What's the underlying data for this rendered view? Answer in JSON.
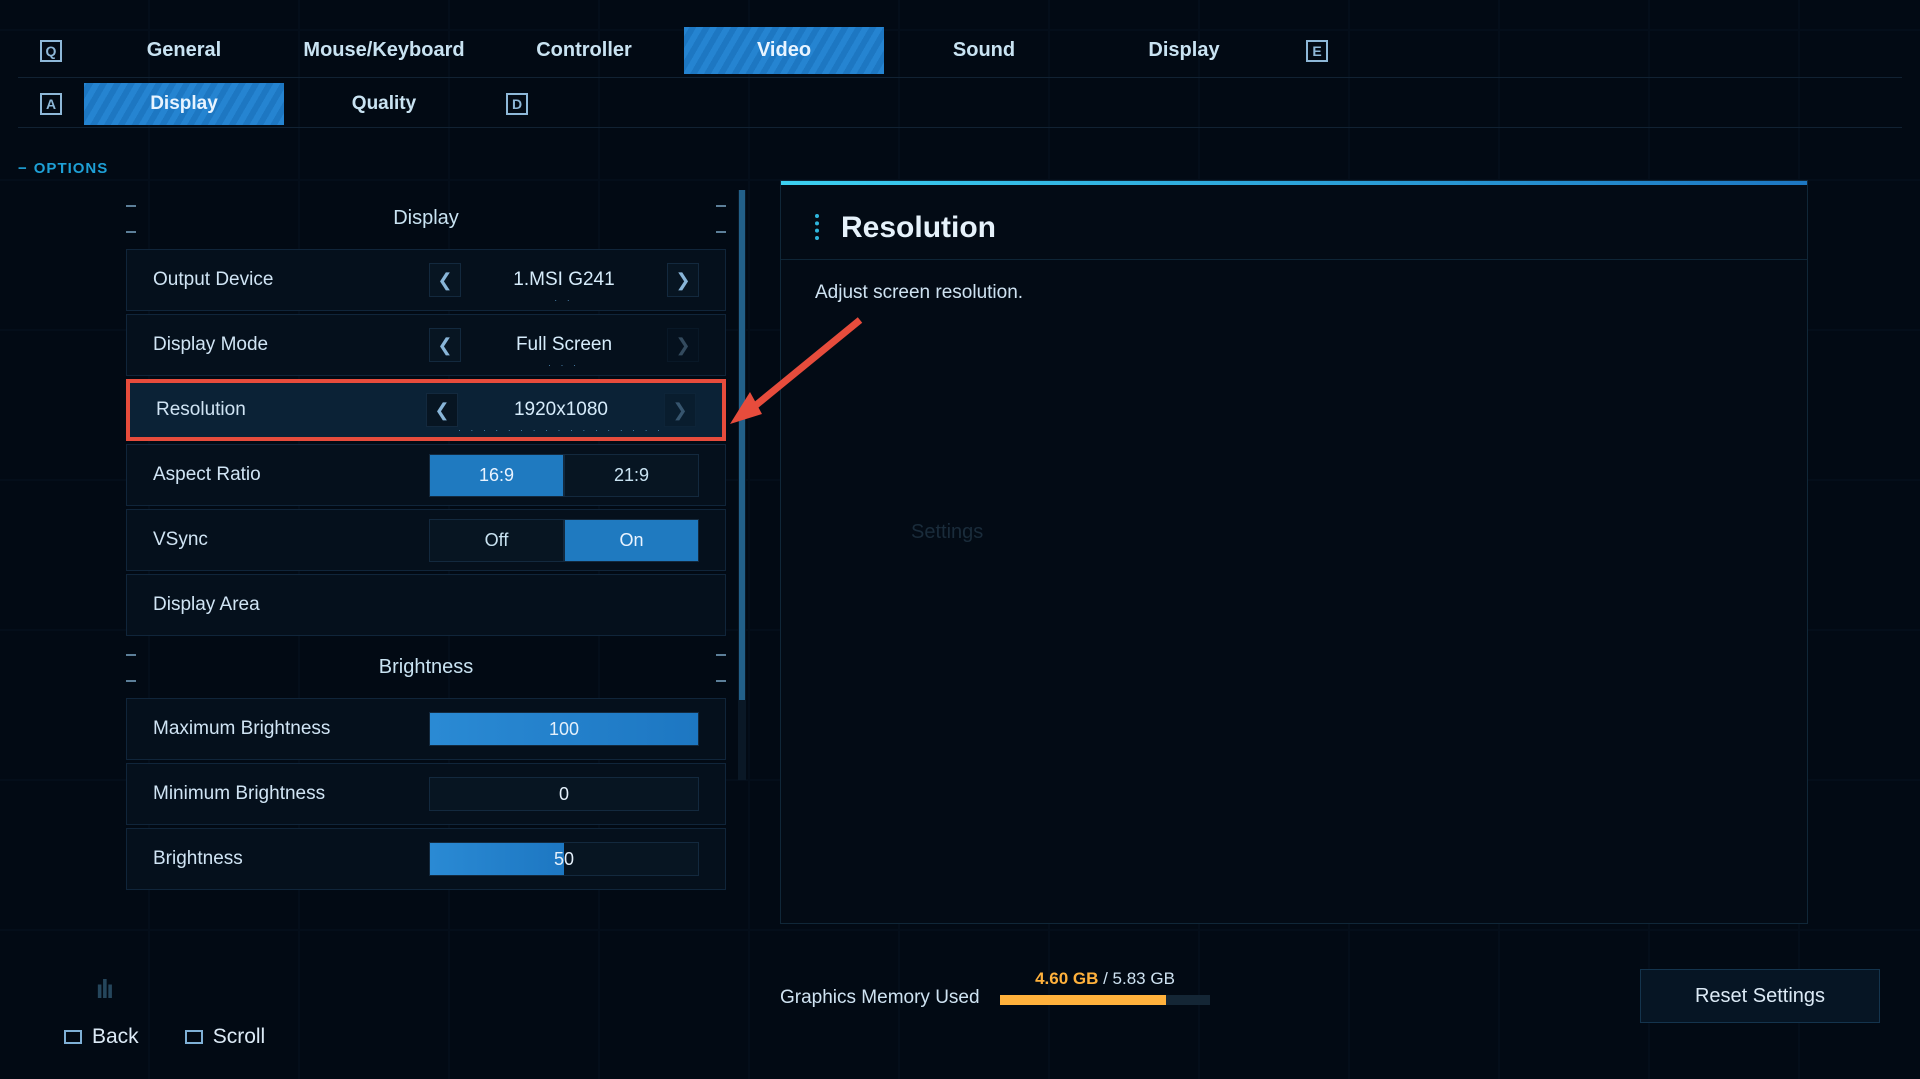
{
  "keys": {
    "left": "Q",
    "right": "E",
    "secLeft": "A",
    "secRight": "D"
  },
  "tabs": [
    "General",
    "Mouse/Keyboard",
    "Controller",
    "Video",
    "Sound",
    "Display"
  ],
  "subtabs": [
    "Display",
    "Quality"
  ],
  "options_label": "OPTIONS",
  "sections": {
    "display_header": "Display",
    "brightness_header": "Brightness"
  },
  "rows": {
    "outputDevice": {
      "label": "Output Device",
      "value": "1.MSI G241",
      "dots": ". ."
    },
    "displayMode": {
      "label": "Display Mode",
      "value": "Full Screen",
      "dots": ". . ."
    },
    "resolution": {
      "label": "Resolution",
      "value": "1920x1080",
      "dots": ". . . . . . . . . . . . . . . . ."
    },
    "aspect": {
      "label": "Aspect Ratio",
      "opt1": "16:9",
      "opt2": "21:9"
    },
    "vsync": {
      "label": "VSync",
      "opt1": "Off",
      "opt2": "On"
    },
    "displayArea": {
      "label": "Display Area"
    },
    "maxBright": {
      "label": "Maximum Brightness",
      "value": "100",
      "fill": 100
    },
    "minBright": {
      "label": "Minimum Brightness",
      "value": "0",
      "fill": 0
    },
    "bright": {
      "label": "Brightness",
      "value": "50",
      "fill": 50
    }
  },
  "desc": {
    "title": "Resolution",
    "body": "Adjust screen resolution.",
    "ghost": "Settings"
  },
  "memory": {
    "label": "Graphics Memory Used",
    "used": "4.60 GB",
    "total": "5.83 GB",
    "sep": " / ",
    "pct": 79
  },
  "reset": "Reset Settings",
  "footer": {
    "back": "Back",
    "scroll": "Scroll"
  }
}
